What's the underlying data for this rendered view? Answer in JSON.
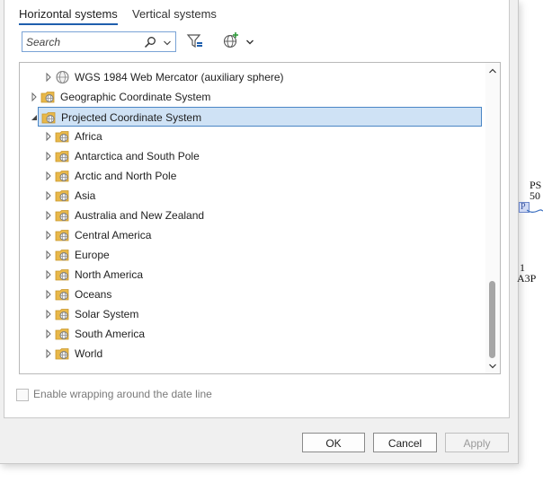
{
  "tabs": [
    {
      "label": "Horizontal systems",
      "active": true
    },
    {
      "label": "Vertical systems",
      "active": false
    }
  ],
  "search": {
    "placeholder": "Search"
  },
  "tree": {
    "items": [
      {
        "label": "WGS 1984 Web Mercator (auxiliary sphere)",
        "level": 2,
        "icon": "globe-icon",
        "expanded": false
      },
      {
        "label": "Geographic Coordinate System",
        "level": 1,
        "icon": "folder-globe-icon",
        "expanded": false
      },
      {
        "label": "Projected Coordinate System",
        "level": 1,
        "icon": "folder-globe-icon",
        "expanded": true,
        "selected": true
      },
      {
        "label": "Africa",
        "level": 2,
        "icon": "folder-globe-icon",
        "expanded": false
      },
      {
        "label": "Antarctica and South Pole",
        "level": 2,
        "icon": "folder-globe-icon",
        "expanded": false
      },
      {
        "label": "Arctic and North Pole",
        "level": 2,
        "icon": "folder-globe-icon",
        "expanded": false
      },
      {
        "label": "Asia",
        "level": 2,
        "icon": "folder-globe-icon",
        "expanded": false
      },
      {
        "label": "Australia and New Zealand",
        "level": 2,
        "icon": "folder-globe-icon",
        "expanded": false
      },
      {
        "label": "Central America",
        "level": 2,
        "icon": "folder-globe-icon",
        "expanded": false
      },
      {
        "label": "Europe",
        "level": 2,
        "icon": "folder-globe-icon",
        "expanded": false
      },
      {
        "label": "North America",
        "level": 2,
        "icon": "folder-globe-icon",
        "expanded": false
      },
      {
        "label": "Oceans",
        "level": 2,
        "icon": "folder-globe-icon",
        "expanded": false
      },
      {
        "label": "Solar System",
        "level": 2,
        "icon": "folder-globe-icon",
        "expanded": false
      },
      {
        "label": "South America",
        "level": 2,
        "icon": "folder-globe-icon",
        "expanded": false
      },
      {
        "label": "World",
        "level": 2,
        "icon": "folder-globe-icon",
        "expanded": false
      }
    ]
  },
  "wrap_option": {
    "label": "Enable wrapping around the date line",
    "checked": false,
    "enabled": false
  },
  "buttons": {
    "ok": "OK",
    "cancel": "Cancel",
    "apply": "Apply"
  },
  "background_fragments": {
    "ps": "PS",
    "fifty": "50",
    "p": "P",
    "one": "1",
    "a3p": "A3P"
  },
  "colors": {
    "accent": "#1f5fad",
    "selection": "#cfe2f5",
    "folder": "#e8b84a"
  }
}
